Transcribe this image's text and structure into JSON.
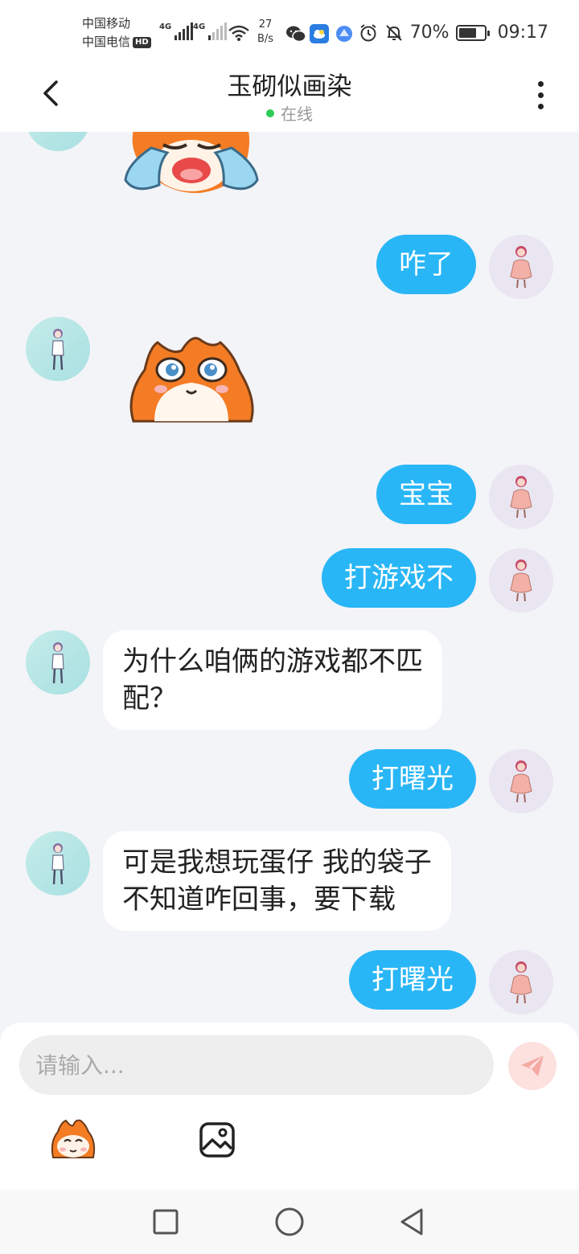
{
  "status_bar": {
    "carrier1": "中国移动",
    "carrier2": "中国电信",
    "hd_badge": "HD",
    "network1": "4G",
    "network2": "4G",
    "speed_value": "27",
    "speed_unit": "B/s",
    "battery_percent": "70%",
    "battery_level": 0.7,
    "time": "09:17",
    "icons": [
      "wechat-icon",
      "weather-app-icon",
      "browser-app-icon",
      "alarm-icon",
      "mute-bell-icon",
      "wifi-icon",
      "battery-icon"
    ]
  },
  "header": {
    "title": "玉砌似画染",
    "presence": "在线",
    "presence_color": "#2ecc55"
  },
  "messages": [
    {
      "from": "other",
      "type": "sticker",
      "sticker": "crying-cat-sticker"
    },
    {
      "from": "me",
      "type": "text",
      "text": "咋了"
    },
    {
      "from": "other",
      "type": "sticker",
      "sticker": "teary-eyed-cat-sticker"
    },
    {
      "from": "me",
      "type": "text",
      "text": "宝宝"
    },
    {
      "from": "me",
      "type": "text",
      "text": "打游戏不"
    },
    {
      "from": "other",
      "type": "text",
      "line1": "为什么咱俩的游戏都不匹",
      "line2": "配？"
    },
    {
      "from": "me",
      "type": "text",
      "text": "打曙光"
    },
    {
      "from": "other",
      "type": "text",
      "line1": "可是我想玩蛋仔 我的袋子",
      "line2": "不知道咋回事，要下载"
    },
    {
      "from": "me",
      "type": "text",
      "text": "打曙光"
    }
  ],
  "input": {
    "placeholder": "请输入..."
  },
  "colors": {
    "accent": "#29b6f6",
    "background": "#f3f4f8",
    "send_button": "#fce1df"
  }
}
